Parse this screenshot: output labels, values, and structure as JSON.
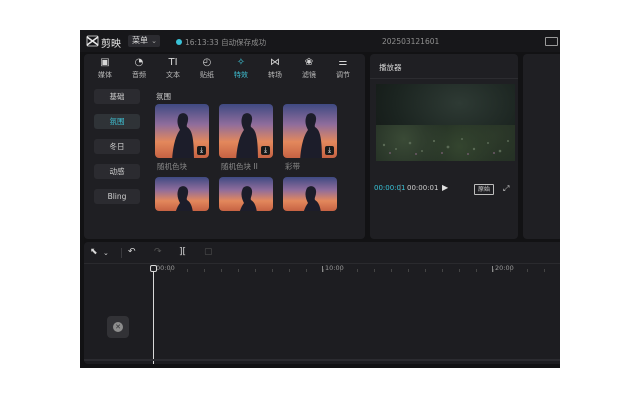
{
  "titlebar": {
    "app_name": "剪映",
    "menu_label": "菜单",
    "save_status": "16:13:33 自动保存成功",
    "project_name": "202503121601",
    "accent_color": "#39c2d7"
  },
  "tabs": [
    {
      "label": "媒体",
      "icon": "media-icon",
      "glyph": "▣"
    },
    {
      "label": "音频",
      "icon": "audio-icon",
      "glyph": "◔"
    },
    {
      "label": "文本",
      "icon": "text-icon",
      "glyph": "TI"
    },
    {
      "label": "贴纸",
      "icon": "sticker-icon",
      "glyph": "◴"
    },
    {
      "label": "特效",
      "icon": "effects-icon",
      "glyph": "✧",
      "active": true
    },
    {
      "label": "转场",
      "icon": "transition-icon",
      "glyph": "⋈"
    },
    {
      "label": "滤镜",
      "icon": "filter-icon",
      "glyph": "❀"
    },
    {
      "label": "调节",
      "icon": "adjust-icon",
      "glyph": "⚌"
    }
  ],
  "categories": [
    {
      "label": "基础"
    },
    {
      "label": "氛围",
      "active": true
    },
    {
      "label": "冬日"
    },
    {
      "label": "动感"
    },
    {
      "label": "Bling"
    }
  ],
  "section_title": "氛围",
  "effects": [
    {
      "label": "随机色块"
    },
    {
      "label": "随机色块 II"
    },
    {
      "label": "彩带"
    },
    {
      "label": ""
    },
    {
      "label": ""
    },
    {
      "label": ""
    }
  ],
  "player": {
    "title": "播放器",
    "current_time": "00:00:01",
    "separator": "|",
    "total_time": "00:00:01",
    "ratio_label": "原始"
  },
  "timeline": {
    "ruler_labels": [
      "00:00",
      "10:00",
      "20:00"
    ]
  }
}
